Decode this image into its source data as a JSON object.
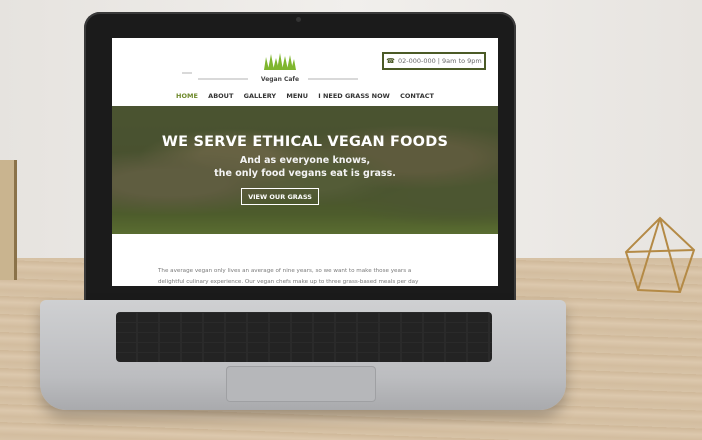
{
  "site": {
    "brand": "Vegan Cafe",
    "phone": "02-000-000 | 9am to 9pm",
    "phone_icon": "phone-icon"
  },
  "nav": {
    "items": [
      {
        "label": "HOME",
        "active": true
      },
      {
        "label": "ABOUT",
        "active": false
      },
      {
        "label": "GALLERY",
        "active": false
      },
      {
        "label": "MENU",
        "active": false
      },
      {
        "label": "I NEED GRASS NOW",
        "active": false
      },
      {
        "label": "CONTACT",
        "active": false
      }
    ]
  },
  "hero": {
    "title": "WE SERVE ETHICAL VEGAN FOODS",
    "line1": "And as everyone knows,",
    "line2": "the only food vegans eat is grass.",
    "button": "VIEW OUR GRASS"
  },
  "body": {
    "line1": "The average vegan only lives an average of nine years, so we want to make those years a",
    "line2": "delightful culinary experience. Our vegan chefs make up to three grass-based meals per day"
  },
  "colors": {
    "accent": "#6f8a2c",
    "border_green": "#4b5a26"
  }
}
